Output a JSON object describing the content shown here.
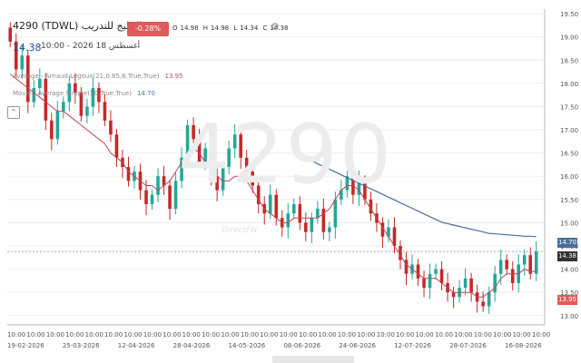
{
  "header": {
    "title": "4290  (TDWL) الخليج للتدريب",
    "price": "14.38",
    "datetime": "10:00 - 2026 أغسطس 18",
    "change": "-0.28%(-0.04)",
    "ohlc": [
      "O",
      "14.98",
      "H",
      "14.98",
      "L",
      "14.34",
      "C",
      "14.38"
    ]
  },
  "indicators": [
    {
      "label": "Average - Arnaud Legoux(21,0.85,6,True,True)",
      "value": "13.95",
      "color": "#c0455a"
    },
    {
      "label": "Moving Average Simple(50,True,True)",
      "value": "14.70",
      "color": "#4a6d9a"
    }
  ],
  "watermark": {
    "symbol": "4290",
    "brand": "DirectFN"
  },
  "badges": {
    "ma": "14.70",
    "price": "14.38",
    "alma": "13.95"
  },
  "colors": {
    "up": "#26a69a",
    "down": "#c62828",
    "alma": "#c0455a",
    "sma": "#4a6d9a",
    "grid": "#eeeeee",
    "axis": "#bbbbbb"
  },
  "chart_data": {
    "type": "candlestick",
    "ylim": [
      12.8,
      19.6
    ],
    "y_ticks": [
      "19.50",
      "19.00",
      "18.50",
      "18.00",
      "17.50",
      "17.00",
      "16.50",
      "16.00",
      "15.50",
      "15.00",
      "14.50",
      "14.00",
      "13.50",
      "13.00"
    ],
    "x_ticks_top": [
      "10:00",
      "10:00",
      "10:00",
      "10:00",
      "10:00",
      "10:00",
      "10:00",
      "10:00",
      "10:00",
      "10:00",
      "10:00",
      "10:00",
      "10:00",
      "10:00",
      "10:00",
      "10:00",
      "10:00",
      "10:00",
      "10:00",
      "10:00",
      "10:00",
      "10:00",
      "10:00",
      "10:00",
      "10:00",
      "10:00",
      "10:00",
      "10:00"
    ],
    "x_ticks_bottom": [
      "19-02-2026",
      "25-03-2026",
      "12-04-2026",
      "28-04-2026",
      "14-05-2026",
      "08-06-2026",
      "24-06-2026",
      "12-07-2026",
      "28-07-2026",
      "16-08-2026"
    ],
    "close": [
      18.9,
      18.3,
      18.6,
      17.6,
      17.9,
      18.1,
      17.2,
      16.8,
      17.4,
      17.6,
      18.0,
      17.8,
      17.3,
      17.5,
      17.9,
      17.6,
      17.2,
      16.9,
      16.4,
      16.2,
      15.9,
      16.1,
      15.7,
      15.4,
      15.6,
      16.0,
      15.8,
      15.3,
      15.9,
      16.4,
      17.1,
      16.8,
      16.3,
      16.6,
      16.0,
      15.7,
      16.2,
      16.6,
      16.9,
      16.4,
      16.1,
      15.8,
      15.4,
      15.2,
      15.6,
      15.1,
      14.9,
      15.2,
      15.4,
      15.0,
      14.8,
      15.1,
      15.3,
      14.8,
      14.9,
      15.5,
      15.7,
      16.0,
      15.6,
      15.9,
      15.5,
      15.2,
      15.0,
      14.7,
      14.9,
      14.5,
      14.2,
      13.9,
      14.1,
      13.8,
      13.6,
      13.9,
      14.0,
      13.7,
      13.5,
      13.4,
      13.6,
      13.8,
      13.5,
      13.3,
      13.2,
      13.5,
      13.9,
      14.2,
      14.0,
      13.7,
      14.1,
      14.3,
      13.9,
      14.38
    ],
    "alma": [
      18.2,
      18.1,
      18.0,
      17.9,
      17.8,
      17.7,
      17.6,
      17.5,
      17.4,
      17.4,
      17.3,
      17.2,
      17.1,
      17.0,
      16.9,
      16.8,
      16.7,
      16.5,
      16.4,
      16.3,
      16.1,
      16.0,
      15.9,
      15.8,
      15.8,
      15.7,
      15.8,
      15.9,
      16.1,
      16.3,
      16.5,
      16.6,
      16.5,
      16.3,
      16.1,
      16.0,
      15.9,
      15.9,
      16.0,
      16.0,
      15.9,
      15.7,
      15.5,
      15.3,
      15.2,
      15.1,
      15.0,
      15.0,
      15.1,
      15.1,
      15.1,
      15.1,
      15.1,
      15.2,
      15.3,
      15.5,
      15.7,
      15.8,
      15.8,
      15.7,
      15.5,
      15.3,
      15.1,
      14.9,
      14.7,
      14.5,
      14.3,
      14.1,
      14.0,
      13.9,
      13.8,
      13.8,
      13.8,
      13.7,
      13.6,
      13.5,
      13.5,
      13.5,
      13.5,
      13.4,
      13.4,
      13.5,
      13.6,
      13.8,
      13.9,
      13.9,
      13.9,
      14.0,
      13.95,
      13.95
    ],
    "sma_start_index": 49,
    "sma": [
      16.45,
      16.39,
      16.33,
      16.27,
      16.21,
      16.15,
      16.09,
      16.03,
      15.97,
      15.91,
      15.85,
      15.79,
      15.73,
      15.67,
      15.61,
      15.55,
      15.49,
      15.43,
      15.37,
      15.31,
      15.25,
      15.19,
      15.13,
      15.07,
      15.01,
      14.98,
      14.95,
      14.92,
      14.89,
      14.86,
      14.83,
      14.8,
      14.77,
      14.76,
      14.75,
      14.74,
      14.73,
      14.72,
      14.71,
      14.71,
      14.7
    ]
  }
}
